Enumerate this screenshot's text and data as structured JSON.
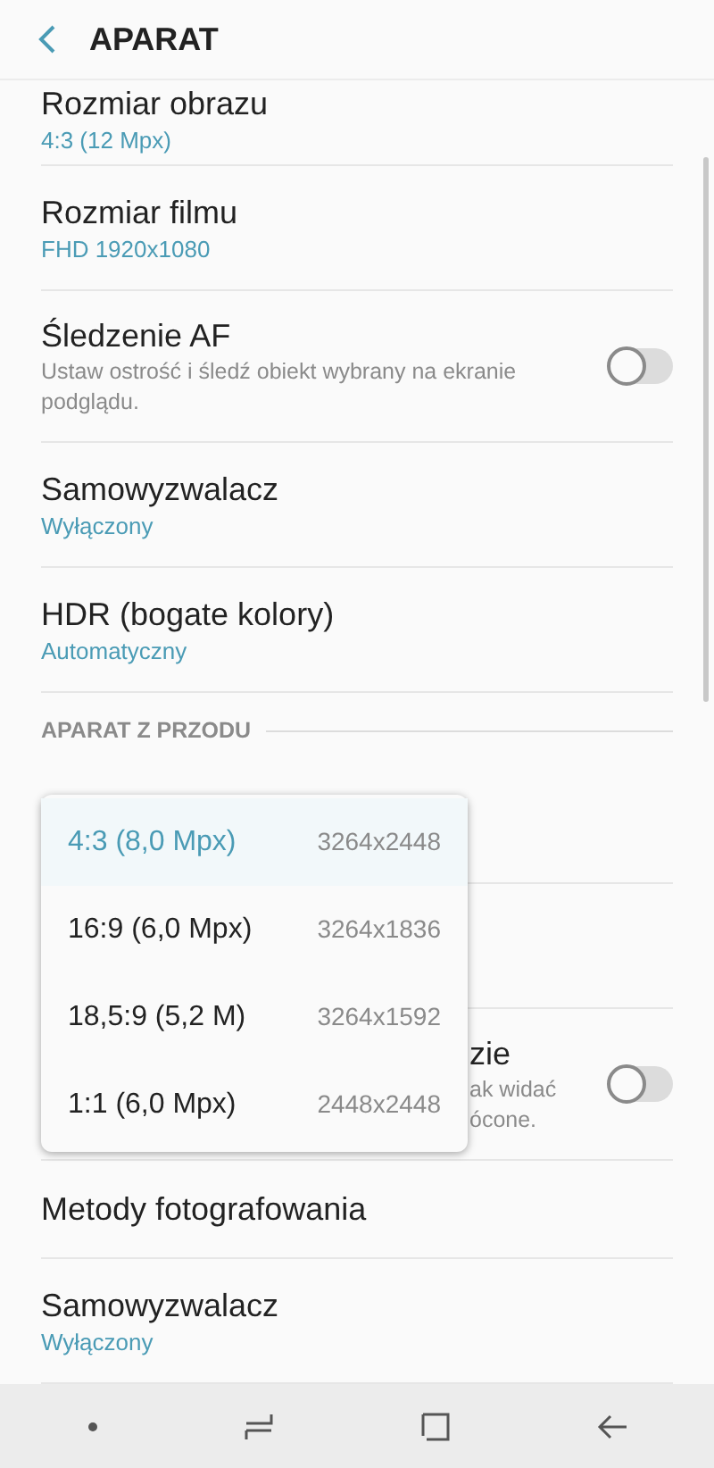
{
  "header": {
    "title": "APARAT"
  },
  "items": [
    {
      "kind": "setting",
      "title": "Rozmiar obrazu",
      "value": "4:3 (12 Mpx)"
    },
    {
      "kind": "setting",
      "title": "Rozmiar filmu",
      "value": "FHD 1920x1080"
    },
    {
      "kind": "toggle",
      "title": "Śledzenie AF",
      "description": "Ustaw ostrość i śledź obiekt wybrany na ekranie podglądu.",
      "on": false
    },
    {
      "kind": "setting",
      "title": "Samowyzwalacz",
      "value": "Wyłączony"
    },
    {
      "kind": "setting",
      "title": "HDR (bogate kolory)",
      "value": "Automatyczny"
    },
    {
      "kind": "section",
      "title": "APARAT Z PRZODU"
    },
    {
      "kind": "covered"
    },
    {
      "kind": "covered"
    },
    {
      "kind": "partial",
      "title": "zie",
      "description_lines": [
        "ak widać",
        "ócone."
      ],
      "on": false
    },
    {
      "kind": "plain",
      "title": "Metody fotografowania"
    },
    {
      "kind": "setting",
      "title": "Samowyzwalacz",
      "value": "Wyłączony"
    }
  ],
  "popup": {
    "options": [
      {
        "label": "4:3 (8,0 Mpx)",
        "resolution": "3264x2448",
        "selected": true
      },
      {
        "label": "16:9 (6,0 Mpx)",
        "resolution": "3264x1836",
        "selected": false
      },
      {
        "label": "18,5:9 (5,2 M)",
        "resolution": "3264x1592",
        "selected": false
      },
      {
        "label": "1:1 (6,0 Mpx)",
        "resolution": "2448x2448",
        "selected": false
      }
    ]
  }
}
